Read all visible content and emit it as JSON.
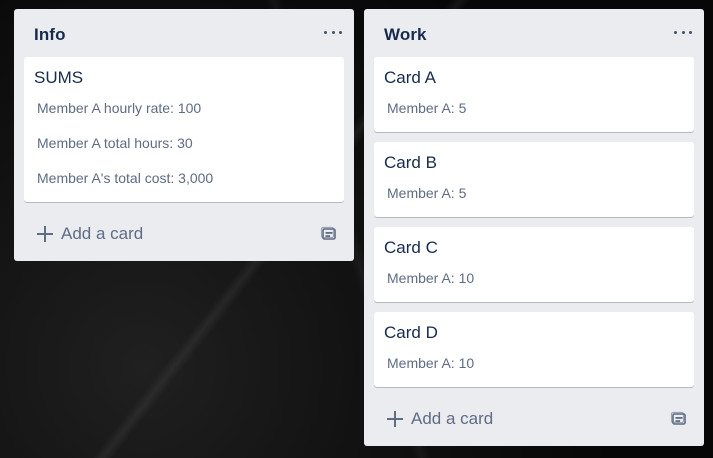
{
  "lists": {
    "info": {
      "title": "Info",
      "add_label": "Add a card",
      "cards": [
        {
          "title": "SUMS",
          "lines": [
            "Member A hourly rate: 100",
            "Member A total hours: 30",
            "Member A's total cost: 3,000"
          ]
        }
      ]
    },
    "work": {
      "title": "Work",
      "add_label": "Add a card",
      "cards": [
        {
          "title": "Card A",
          "lines": [
            "Member A: 5"
          ]
        },
        {
          "title": "Card B",
          "lines": [
            "Member A: 5"
          ]
        },
        {
          "title": "Card C",
          "lines": [
            "Member A: 10"
          ]
        },
        {
          "title": "Card D",
          "lines": [
            "Member A: 10"
          ]
        }
      ]
    }
  },
  "icons": {
    "list_menu": "more-horizontal-icon",
    "add_card": "plus-icon",
    "template": "card-template-icon"
  }
}
